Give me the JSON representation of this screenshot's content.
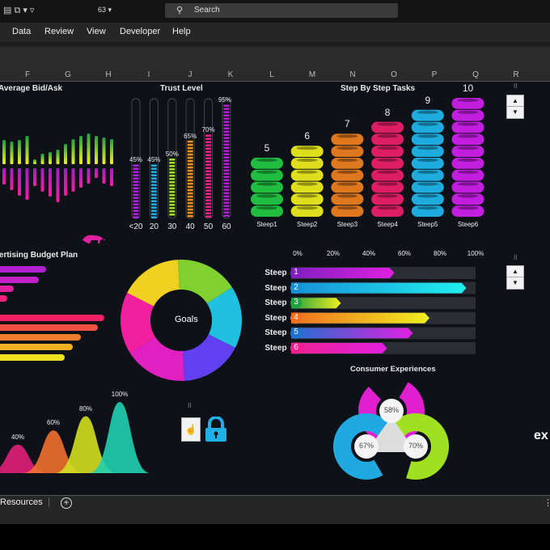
{
  "titlebar": {
    "font_size": "63",
    "search_placeholder": "Search"
  },
  "menu": [
    "Data",
    "Review",
    "View",
    "Developer",
    "Help"
  ],
  "columns": [
    "F",
    "G",
    "H",
    "I",
    "J",
    "K",
    "L",
    "M",
    "N",
    "O",
    "P",
    "Q",
    "R"
  ],
  "bid_ask": {
    "title": "Average Bid/Ask",
    "bid": [
      30,
      28,
      30,
      35,
      6,
      13,
      15,
      18,
      25,
      31,
      35,
      38,
      35,
      33,
      31
    ],
    "ask": [
      20,
      27,
      34,
      39,
      22,
      29,
      35,
      42,
      34,
      29,
      24,
      19,
      12,
      19,
      22
    ]
  },
  "trust": {
    "title": "Trust Level",
    "items": [
      {
        "label": "<20",
        "pct": 45,
        "text": "45%",
        "color": "#b020e0"
      },
      {
        "label": "20",
        "pct": 45,
        "text": "45%",
        "color": "#20a8e0"
      },
      {
        "label": "30",
        "pct": 50,
        "text": "50%",
        "color": "#a0e020"
      },
      {
        "label": "40",
        "pct": 65,
        "text": "65%",
        "color": "#f09020"
      },
      {
        "label": "50",
        "pct": 70,
        "text": "70%",
        "color": "#f0208a"
      },
      {
        "label": "60",
        "pct": 95,
        "text": "95%",
        "color": "#b020d0"
      }
    ]
  },
  "steps": {
    "title": "Step By Step Tasks",
    "items": [
      {
        "label": "Steep1",
        "value": 5,
        "text": "5",
        "color": "#22cc44"
      },
      {
        "label": "Steep2",
        "value": 6,
        "text": "6",
        "color": "#f0f020"
      },
      {
        "label": "Steep3",
        "value": 7,
        "text": "7",
        "color": "#f08020"
      },
      {
        "label": "Steep4",
        "value": 8,
        "text": "8",
        "color": "#f0206a"
      },
      {
        "label": "Steep5",
        "value": 9,
        "text": "9",
        "color": "#20b8f0"
      },
      {
        "label": "Steep6",
        "value": 10,
        "text": "10",
        "color": "#d020f0"
      }
    ]
  },
  "budget": {
    "title": "Advertising Budget Plan",
    "bars": [
      {
        "w": 57,
        "color": "#b020d0"
      },
      {
        "w": 48,
        "color": "#c020c8"
      },
      {
        "w": 17,
        "color": "#e020a0"
      },
      {
        "w": 9,
        "color": "#f02080"
      },
      {
        "w": 129,
        "color": "#f02060"
      },
      {
        "w": 121,
        "color": "#f05040"
      },
      {
        "w": 100,
        "color": "#f08030"
      },
      {
        "w": 90,
        "color": "#f0b020"
      },
      {
        "w": 80,
        "color": "#f0e020"
      }
    ]
  },
  "goals": {
    "label": "Goals",
    "segments": [
      {
        "color": "#f0d020"
      },
      {
        "color": "#80d030"
      },
      {
        "color": "#20c0e0"
      },
      {
        "color": "#6040f0"
      },
      {
        "color": "#e020c0"
      },
      {
        "color": "#f020a0"
      }
    ]
  },
  "progress": {
    "axis": [
      "0%",
      "20%",
      "40%",
      "60%",
      "80%",
      "100%"
    ],
    "items": [
      {
        "label": "Steep",
        "num": "1",
        "pct": 56,
        "c1": "#8020c0",
        "c2": "#e020e0"
      },
      {
        "label": "Steep",
        "num": "2",
        "pct": 95,
        "c1": "#1890d8",
        "c2": "#20f0f0"
      },
      {
        "label": "Steep",
        "num": "3",
        "pct": 27,
        "c1": "#20a040",
        "c2": "#f0f020"
      },
      {
        "label": "Steep",
        "num": "4",
        "pct": 75,
        "c1": "#f07020",
        "c2": "#f0f020"
      },
      {
        "label": "Steep",
        "num": "5",
        "pct": 66,
        "c1": "#2070d0",
        "c2": "#e020e0"
      },
      {
        "label": "Steep",
        "num": "6",
        "pct": 52,
        "c1": "#f02090",
        "c2": "#e020e0"
      }
    ]
  },
  "waves": [
    {
      "text": "40%",
      "v": 40,
      "color": "#e0207a"
    },
    {
      "text": "60%",
      "v": 60,
      "color": "#f07030"
    },
    {
      "text": "80%",
      "v": 80,
      "color": "#d0e020"
    },
    {
      "text": "100%",
      "v": 100,
      "color": "#20d0b0"
    }
  ],
  "consumer": {
    "title": "Consumer Experiences",
    "items": [
      {
        "text": "58%"
      },
      {
        "text": "67%"
      },
      {
        "text": "70%"
      }
    ]
  },
  "side_text": "ex",
  "pause_label": "II",
  "sheet_tab": "Resources"
}
